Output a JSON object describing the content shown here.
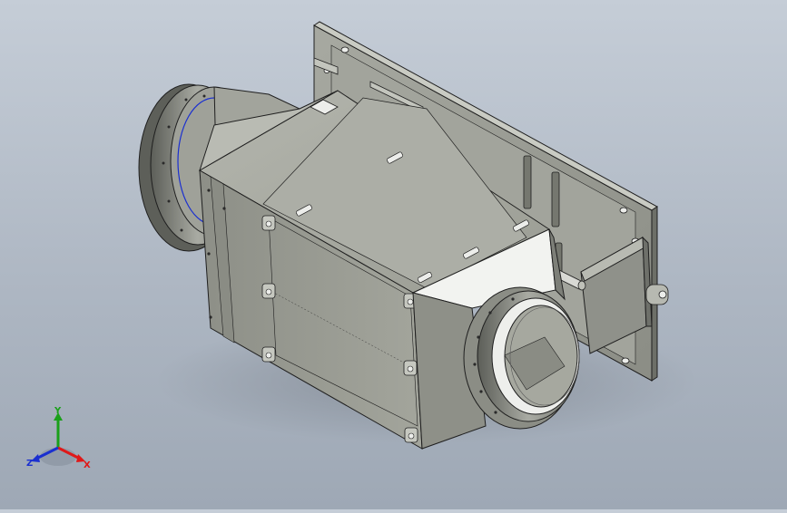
{
  "viewport": {
    "background_top": "#c5cdd7",
    "background_bottom": "#9ea8b5",
    "model_body_color": "#9b9d94",
    "model_light_color": "#f2f3f0",
    "edge_color": "#1f1f1f"
  },
  "triad": {
    "x_label": "X",
    "y_label": "Y",
    "z_label": "Z",
    "x_color": "#e01818",
    "y_color": "#1aa01a",
    "z_color": "#1a2fd0"
  }
}
